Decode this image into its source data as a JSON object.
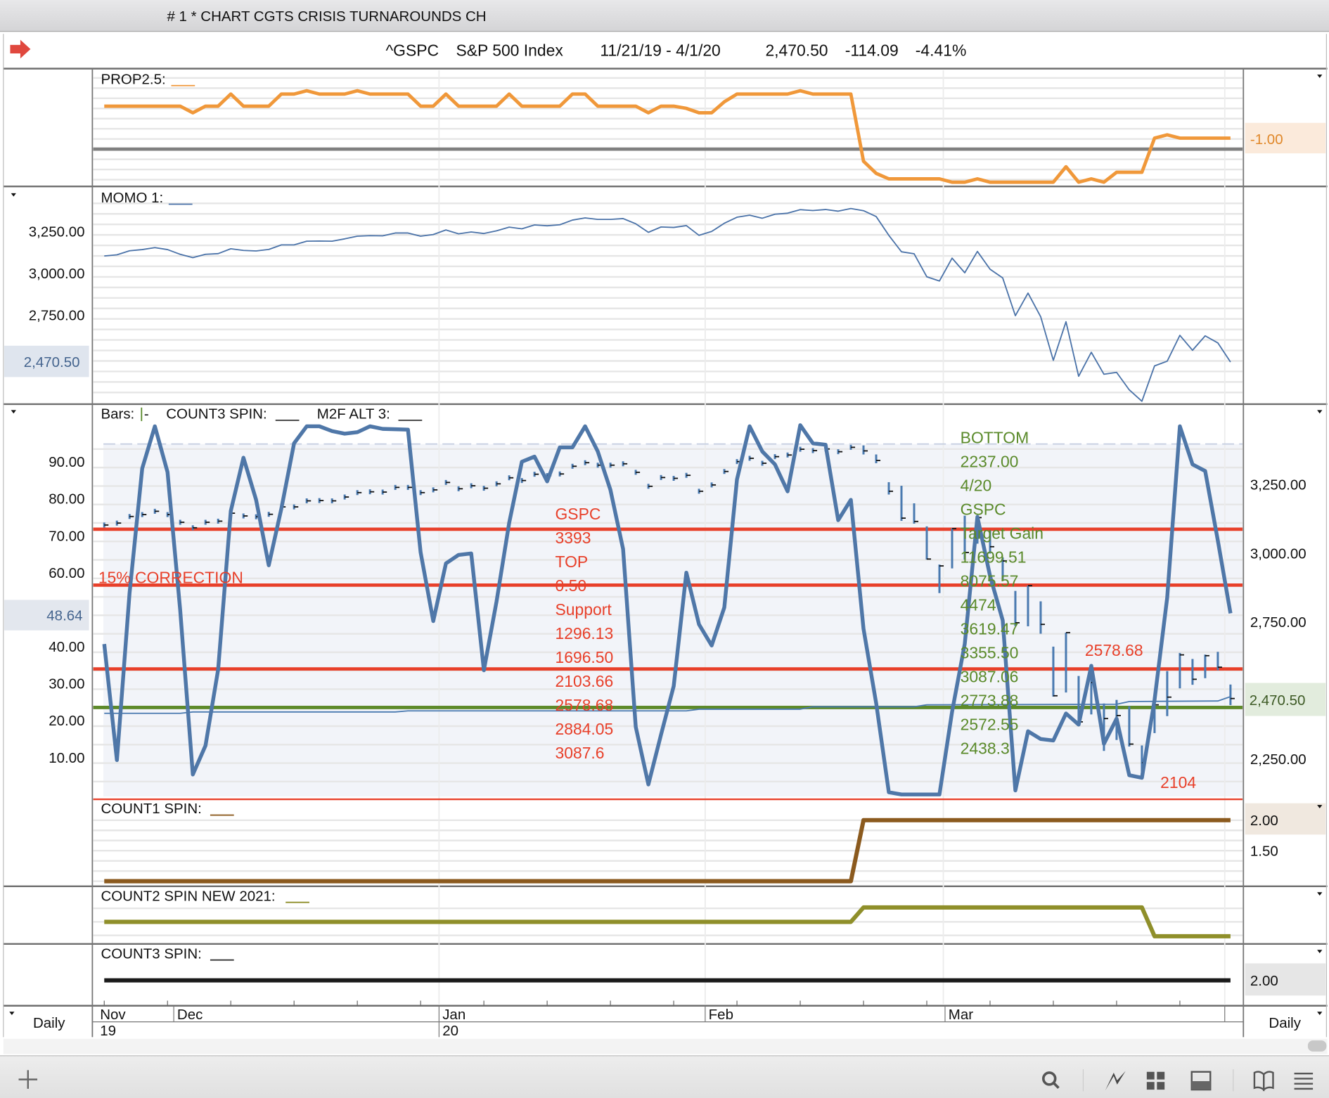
{
  "window": {
    "title": "# 1 * CHART CGTS CRISIS TURNAROUNDS CH"
  },
  "header": {
    "arrow_icon": "red-right-arrow-icon",
    "symbol": "^GSPC",
    "name": "S&P 500 Index",
    "date_range": "11/21/19 - 4/1/20",
    "last": "2,470.50",
    "change": "-114.09",
    "change_pct": "-4.41%"
  },
  "panels": {
    "prop": {
      "label": "PROP2.5:",
      "value_box": "-1.00",
      "color": "#f0983a"
    },
    "momo": {
      "label": "MOMO 1:",
      "value_box": "2,470.50",
      "ticks": [
        "3,250.00",
        "3,000.00",
        "2,750.00"
      ],
      "color": "#4a72a8"
    },
    "main": {
      "label_bars": "Bars:",
      "label_count3": "COUNT3 SPIN:",
      "label_m2f": "M2F ALT 3:",
      "left_value_box": "48.64",
      "right_value_box": "2,470.50",
      "left_ticks": [
        "90.00",
        "80.00",
        "70.00",
        "60.00",
        "40.00",
        "30.00",
        "20.00",
        "10.00"
      ],
      "right_ticks": [
        "3,250.00",
        "3,000.00",
        "2,750.00",
        "2,250.00"
      ],
      "correction_label": "15% CORRECTION",
      "red_notes": [
        "GSPC",
        "3393",
        "TOP",
        "0.50",
        "Support",
        "1296.13",
        "1696.50",
        "2103.66",
        "2578.68",
        "2884.05",
        "3087.6"
      ],
      "green_notes": [
        "BOTTOM",
        "2237.00",
        "4/20",
        "GSPC",
        "Target Gain",
        "11699.51",
        "8075.57",
        "4474",
        "3619.47",
        "3355.50",
        "3087.06",
        "2773.88",
        "2572.55",
        "2438.3"
      ],
      "peak_label": "2578.68",
      "low_label": "2104"
    },
    "count1": {
      "label": "COUNT1 SPIN:",
      "ticks": [
        "2.00",
        "1.50"
      ],
      "color": "#8b5a1e"
    },
    "count2": {
      "label": "COUNT2 SPIN NEW 2021:",
      "color": "#8f8f2a"
    },
    "count3": {
      "label": "COUNT3 SPIN:",
      "value_box": "2.00",
      "color": "#1a1a1a"
    }
  },
  "time_axis": {
    "months": [
      "Nov",
      "Dec",
      "Jan",
      "Feb",
      "Mar"
    ],
    "years": [
      "19",
      "20"
    ],
    "period_left": "Daily",
    "period_right": "Daily"
  },
  "toolbar": {
    "icons": [
      "add-icon",
      "search-icon",
      "chart-line-icon",
      "grid-icon",
      "layout-icon",
      "book-icon",
      "menu-icon"
    ]
  },
  "chart_data": {
    "type": "line",
    "x_range": [
      "11/21/19",
      "4/1/20"
    ],
    "price": {
      "close": [
        3103,
        3110,
        3134,
        3141,
        3153,
        3141,
        3113,
        3093,
        3113,
        3117,
        3146,
        3136,
        3133,
        3142,
        3169,
        3169,
        3191,
        3192,
        3191,
        3205,
        3221,
        3224,
        3223,
        3240,
        3240,
        3221,
        3231,
        3258,
        3235,
        3246,
        3237,
        3253,
        3275,
        3265,
        3288,
        3283,
        3289,
        3317,
        3330,
        3321,
        3321,
        3326,
        3295,
        3244,
        3276,
        3273,
        3284,
        3226,
        3249,
        3298,
        3334,
        3346,
        3328,
        3352,
        3358,
        3379,
        3374,
        3380,
        3370,
        3386,
        3373,
        3338,
        3226,
        3128,
        3116,
        2979,
        2954,
        3090,
        3003,
        3130,
        3024,
        2972,
        2747,
        2882,
        2741,
        2481,
        2711,
        2386,
        2529,
        2398,
        2409,
        2305,
        2237,
        2448,
        2476,
        2630,
        2541,
        2627,
        2585,
        2471
      ],
      "high": [
        3112,
        3119,
        3143,
        3150,
        3162,
        3150,
        3122,
        3102,
        3122,
        3126,
        3155,
        3145,
        3142,
        3151,
        3178,
        3178,
        3200,
        3201,
        3200,
        3214,
        3230,
        3233,
        3232,
        3249,
        3249,
        3230,
        3240,
        3267,
        3244,
        3255,
        3246,
        3262,
        3284,
        3274,
        3297,
        3292,
        3298,
        3326,
        3339,
        3330,
        3330,
        3335,
        3304,
        3253,
        3285,
        3282,
        3293,
        3235,
        3258,
        3307,
        3343,
        3355,
        3337,
        3361,
        3367,
        3388,
        3383,
        3389,
        3379,
        3395,
        3393,
        3360,
        3259,
        3246,
        3182,
        3098,
        2959,
        3091,
        3137,
        3131,
        3083,
        2985,
        2863,
        2883,
        2825,
        2660,
        2711,
        2553,
        2562,
        2453,
        2466,
        2443,
        2300,
        2449,
        2571,
        2637,
        2615,
        2631,
        2641,
        2522
      ],
      "low": [
        3094,
        3101,
        3125,
        3132,
        3144,
        3132,
        3104,
        3084,
        3104,
        3108,
        3137,
        3127,
        3124,
        3133,
        3160,
        3160,
        3182,
        3183,
        3182,
        3196,
        3212,
        3215,
        3214,
        3231,
        3231,
        3212,
        3222,
        3249,
        3226,
        3237,
        3228,
        3244,
        3266,
        3256,
        3279,
        3274,
        3280,
        3308,
        3321,
        3312,
        3312,
        3317,
        3286,
        3235,
        3267,
        3264,
        3275,
        3217,
        3240,
        3289,
        3325,
        3337,
        3319,
        3343,
        3349,
        3370,
        3365,
        3371,
        3361,
        3377,
        3360,
        3328,
        3214,
        3118,
        3108,
        2977,
        2855,
        2945,
        2977,
        3035,
        2999,
        2901,
        2735,
        2734,
        2707,
        2478,
        2493,
        2381,
        2413,
        2280,
        2320,
        2296,
        2192,
        2345,
        2407,
        2508,
        2521,
        2545,
        2574,
        2447
      ]
    },
    "oscillator": [
      40.7,
      9.3,
      54.5,
      88.2,
      99.6,
      87.2,
      49.9,
      5.4,
      13.2,
      33.8,
      76.7,
      91.1,
      79.7,
      62.0,
      77.4,
      95.0,
      99.6,
      99.6,
      98.3,
      97.6,
      98.0,
      99.6,
      98.9,
      98.8,
      98.7,
      65.5,
      46.9,
      62.5,
      64.8,
      65.2,
      33.6,
      52.2,
      73.5,
      90.0,
      91.4,
      84.7,
      93.9,
      93.9,
      99.6,
      92.8,
      82.4,
      66.4,
      18.3,
      2.7,
      16.2,
      29.3,
      60.0,
      46.0,
      40.3,
      50.6,
      85.2,
      99.6,
      92.8,
      89.3,
      82.0,
      99.9,
      95.0,
      94.6,
      74.2,
      79.7,
      44.8,
      24.7,
      0.6,
      0,
      0,
      0,
      0,
      22.4,
      40.7,
      75.1,
      59.1,
      47.1,
      1.1,
      17.1,
      15.0,
      14.6,
      21.9,
      18.9,
      34.8,
      13.7,
      20.5,
      5.2,
      4.5,
      25.6,
      53.3,
      99.6,
      89.3,
      87.5,
      68.7,
      49.0
    ],
    "slow_line": [
      [
        0,
        2417
      ],
      [
        6,
        2417
      ],
      [
        7,
        2422
      ],
      [
        23,
        2422
      ],
      [
        24,
        2426
      ],
      [
        46,
        2426
      ],
      [
        47,
        2432
      ],
      [
        55,
        2432
      ],
      [
        56,
        2441
      ],
      [
        64,
        2441
      ],
      [
        65,
        2448
      ],
      [
        80,
        2450
      ],
      [
        81,
        2460
      ],
      [
        88,
        2462
      ],
      [
        89,
        2478
      ]
    ],
    "prop": [
      [
        0,
        1.9
      ],
      [
        6,
        1.9
      ],
      [
        7,
        1.3
      ],
      [
        8,
        1.9
      ],
      [
        9,
        1.9
      ],
      [
        10,
        3.0
      ],
      [
        11,
        1.9
      ],
      [
        13,
        1.9
      ],
      [
        14,
        3.0
      ],
      [
        15,
        3.0
      ],
      [
        16,
        3.3
      ],
      [
        17,
        3.0
      ],
      [
        19,
        3.0
      ],
      [
        20,
        3.3
      ],
      [
        21,
        3.0
      ],
      [
        24,
        3.0
      ],
      [
        25,
        1.9
      ],
      [
        26,
        1.9
      ],
      [
        27,
        3.0
      ],
      [
        28,
        1.9
      ],
      [
        31,
        1.9
      ],
      [
        32,
        3.0
      ],
      [
        33,
        1.9
      ],
      [
        36,
        1.9
      ],
      [
        37,
        3.0
      ],
      [
        38,
        3.0
      ],
      [
        39,
        1.9
      ],
      [
        42,
        1.9
      ],
      [
        43,
        1.3
      ],
      [
        44,
        1.9
      ],
      [
        45,
        1.9
      ],
      [
        46,
        1.7
      ],
      [
        47,
        1.3
      ],
      [
        48,
        1.3
      ],
      [
        49,
        2.3
      ],
      [
        50,
        3.0
      ],
      [
        54,
        3.0
      ],
      [
        55,
        3.3
      ],
      [
        56,
        3.0
      ],
      [
        59,
        3.0
      ],
      [
        60,
        -3.1
      ],
      [
        61,
        -4.2
      ],
      [
        62,
        -4.7
      ],
      [
        66,
        -4.7
      ],
      [
        67,
        -5.0
      ],
      [
        68,
        -5.0
      ],
      [
        69,
        -4.7
      ],
      [
        70,
        -5.0
      ],
      [
        75,
        -5.0
      ],
      [
        76,
        -3.6
      ],
      [
        77,
        -5.0
      ],
      [
        78,
        -4.7
      ],
      [
        79,
        -5.0
      ],
      [
        80,
        -4.1
      ],
      [
        82,
        -4.1
      ],
      [
        83,
        -1.0
      ],
      [
        84,
        -0.7
      ],
      [
        85,
        -1.0
      ],
      [
        89,
        -1.0
      ]
    ],
    "prop_reference": -2,
    "levels": {
      "red": [
        3087.6,
        2884.05,
        2578.68,
        2104
      ],
      "green": [
        2438.3
      ]
    },
    "count1": [
      [
        0,
        1
      ],
      [
        59,
        1
      ],
      [
        60,
        2
      ],
      [
        89,
        2
      ]
    ],
    "count2": [
      [
        0,
        1
      ],
      [
        59,
        1
      ],
      [
        60,
        2
      ],
      [
        82,
        2
      ],
      [
        83,
        0
      ],
      [
        89,
        0
      ]
    ],
    "count3": [
      [
        0,
        2
      ],
      [
        89,
        2
      ]
    ],
    "left_axis_range": [
      0,
      100
    ],
    "right_axis_range": [
      2100,
      3400
    ]
  }
}
